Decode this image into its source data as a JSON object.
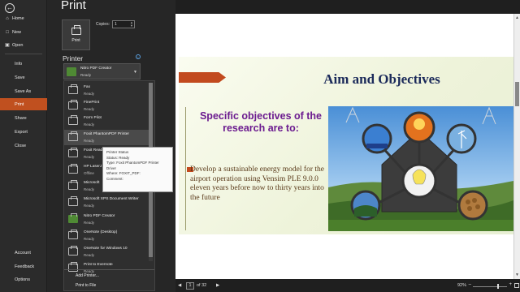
{
  "nav": {
    "back_icon": "back-arrow-icon",
    "items": [
      {
        "label": "Home",
        "icon": "home-icon"
      },
      {
        "label": "New",
        "icon": "new-doc-icon"
      },
      {
        "label": "Open",
        "icon": "folder-icon"
      },
      {
        "label": "Info"
      },
      {
        "label": "Save"
      },
      {
        "label": "Save As"
      },
      {
        "label": "Print"
      },
      {
        "label": "Share"
      },
      {
        "label": "Export"
      },
      {
        "label": "Close"
      }
    ],
    "bottom": [
      {
        "label": "Account"
      },
      {
        "label": "Feedback"
      },
      {
        "label": "Options"
      }
    ],
    "active_color": "#c0501f"
  },
  "print": {
    "title": "Print",
    "button_label": "Print",
    "copies_label": "Copies:",
    "copies_value": "1",
    "printer_heading": "Printer",
    "selected": {
      "name": "Nitro PDF Creator",
      "status": "Ready"
    }
  },
  "printers": [
    {
      "name": "Fax",
      "status": "Ready"
    },
    {
      "name": "FinePrint",
      "status": "Ready"
    },
    {
      "name": "Form Pilot",
      "status": "Ready"
    },
    {
      "name": "Foxit PhantomPDF Printer",
      "status": "Ready"
    },
    {
      "name": "Foxit Read",
      "status": "Ready"
    },
    {
      "name": "HP LaserJ",
      "status": "Offline"
    },
    {
      "name": "Microsoft",
      "status": "Ready"
    },
    {
      "name": "Microsoft XPS Document Writer",
      "status": "Ready"
    },
    {
      "name": "Nitro PDF Creator",
      "status": "Ready"
    },
    {
      "name": "OneNote (Desktop)",
      "status": "Ready"
    },
    {
      "name": "OneNote for Windows 10",
      "status": "Ready"
    },
    {
      "name": "Print to Evernote",
      "status": "Ready"
    }
  ],
  "list_actions": {
    "add_printer": "Add Printer...",
    "print_to_file": "Print to File"
  },
  "tooltip": {
    "title": "Printer Status",
    "lines": [
      "Status: Ready",
      "Type: Foxit PhantomPDF Printer",
      "Driver",
      "Where: FOXIT_PDF:",
      "Comment:"
    ]
  },
  "slide": {
    "title": "Aim and Objectives",
    "subtitle": "Specific objectives of the research are to:",
    "bullet": "Develop a sustainable energy model for the airport operation using Vensim PLE 9.0.0 eleven years before now to thirty years into the future"
  },
  "pager": {
    "page": "1",
    "of": "of 32",
    "zoom": "92%"
  }
}
